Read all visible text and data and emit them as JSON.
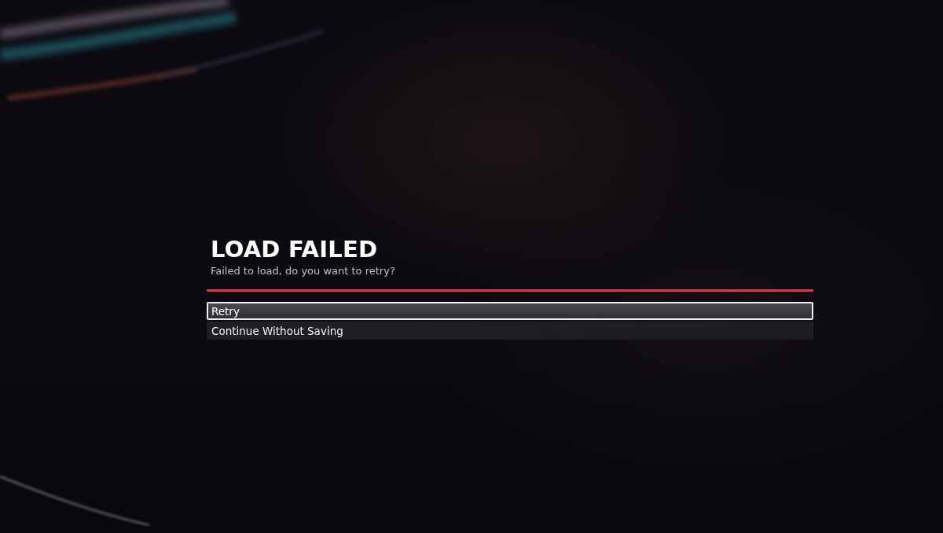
{
  "dialog": {
    "title": "LOAD FAILED",
    "message": "Failed to load, do you want to retry?"
  },
  "options": [
    {
      "label": "Retry",
      "selected": true
    },
    {
      "label": "Continue Without Saving",
      "selected": false
    }
  ]
}
